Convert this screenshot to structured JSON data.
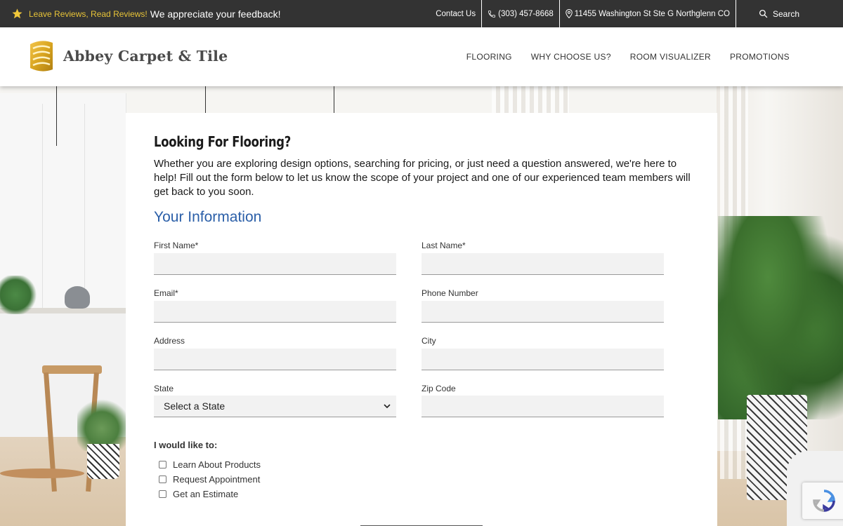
{
  "topbar": {
    "promo_link": "Leave Reviews, Read Reviews!",
    "promo_text": "We appreciate your feedback!",
    "contact": "Contact Us",
    "phone": "(303) 457-8668",
    "address": "11455 Washington St Ste G Northglenn CO",
    "search": "Search"
  },
  "header": {
    "logo_text": "Abbey Carpet & Tile",
    "nav": [
      "FLOORING",
      "WHY CHOOSE US?",
      "ROOM VISUALIZER",
      "PROMOTIONS"
    ]
  },
  "form": {
    "title": "Looking For Flooring?",
    "description": "Whether you are exploring design options, searching for pricing, or just need a question answered, we're here to help! Fill out the form below to let us know the scope of your project and one of our experienced team members will get back to you soon.",
    "section_title": "Your Information",
    "fields": {
      "first_name": "First Name*",
      "last_name": "Last Name*",
      "email": "Email*",
      "phone": "Phone Number",
      "address": "Address",
      "city": "City",
      "state": "State",
      "zip": "Zip Code"
    },
    "state_selected": "Select a State",
    "interest_label": "I would like to:",
    "options": [
      "Learn About Products",
      "Request Appointment",
      "Get an Estimate"
    ]
  },
  "colors": {
    "topbar_bg": "#333333",
    "promo_link": "#e7c338",
    "section_title": "#2b5fa8",
    "logo_gold": "#d9a520"
  },
  "icons": [
    "star-icon",
    "phone-icon",
    "map-pin-icon",
    "search-icon",
    "logo-icon",
    "chevron-down-icon",
    "recaptcha-icon"
  ]
}
